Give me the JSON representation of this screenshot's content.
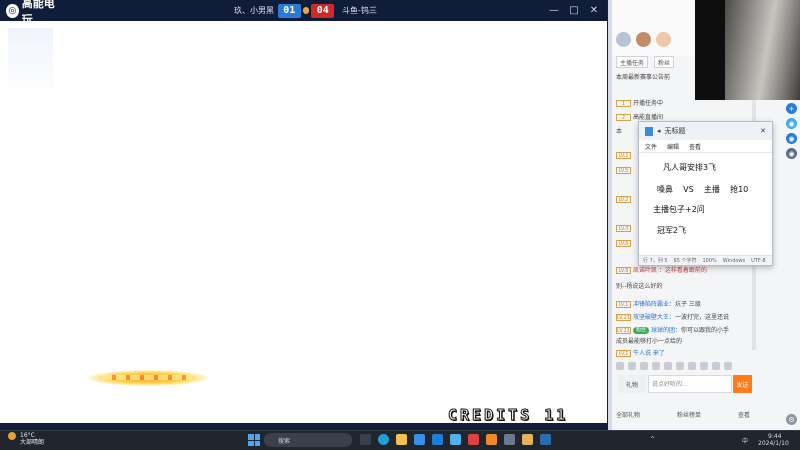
{
  "game": {
    "logo_text": "高能电玩",
    "player1": "玖、小男黑",
    "score1": "01",
    "score2": "04",
    "player2": "斗鱼-钨三",
    "credits": "CREDITS 11",
    "window_buttons": [
      "—",
      "□",
      "✕"
    ]
  },
  "side": {
    "tabs": [
      "主播任务",
      "粉丝"
    ],
    "chat": [
      {
        "level": "",
        "tag": "",
        "name": "",
        "text": "本周最新赛事公告前"
      },
      {
        "level": "1",
        "tag": "",
        "name": "",
        "text": "开播任务中"
      },
      {
        "level": "2",
        "tag": "",
        "name": "",
        "text": "高能直播间"
      },
      {
        "level": "",
        "tag": "",
        "name": "",
        "text": "本"
      },
      {
        "level": "LV.1",
        "tag": "",
        "name": "",
        "text": ""
      },
      {
        "level": "LV.5",
        "tag": "",
        "name": "",
        "text": ""
      },
      {
        "level": "LV.2",
        "tag": "",
        "name": "",
        "text": ""
      },
      {
        "level": "LV.3",
        "tag": "",
        "name": "",
        "text": ""
      },
      {
        "level": "LV.6",
        "tag": "",
        "name": "",
        "text": ""
      },
      {
        "level": "LV.8",
        "tag": "",
        "name": "",
        "text": "凯诺叶凯 ：这样看着跟前的"
      },
      {
        "level": "",
        "tag": "",
        "name": "",
        "text": "别--杨说这么好的"
      },
      {
        "level": "LV.1",
        "tag": "",
        "name": "冲锋陷阵霸业：",
        "text": "坑子 三级"
      },
      {
        "level": "LV.21",
        "tag": "",
        "name": "攻坚破壁大王：",
        "text": "一波打完，这里还说"
      },
      {
        "level": "LV.21",
        "tag": "粉丝",
        "name": "球球的团：",
        "text": "你可以跟我的小手"
      },
      {
        "level": "",
        "tag": "",
        "name": "",
        "text": "成员最能够打小一点给的"
      },
      {
        "level": "LV.1",
        "tag": "",
        "name": "",
        "text": "牛人说 来了"
      }
    ],
    "chat_input_placeholder": "说点好听的...",
    "send_label": "发送",
    "gift_label": "礼物",
    "bottom_left": "全部礼物",
    "bottom_mid": "粉丝榜单",
    "bottom_right": "查看"
  },
  "notepad": {
    "title": "无标题",
    "menu": [
      "文件",
      "编辑",
      "查看"
    ],
    "lines": [
      "凡人哥安排3飞",
      "嗓鼻    VS    主播    抢10",
      "主播包子+2问",
      "冠军2飞"
    ],
    "status": [
      "行 7，列 5",
      "65 个字符",
      "100%",
      "Windows",
      "UTF-8"
    ]
  },
  "taskbar": {
    "weather_temp": "16°C",
    "weather_desc": "大部晴朗",
    "search_placeholder": "搜索",
    "time": "9:44",
    "date": "2024/1/10",
    "lang": "中"
  },
  "colors": {
    "title_bar": "#0f1d3a",
    "score_blue": "#2a7ad8",
    "score_red": "#cf2a2a",
    "accent_orange": "#ff7a1a"
  }
}
